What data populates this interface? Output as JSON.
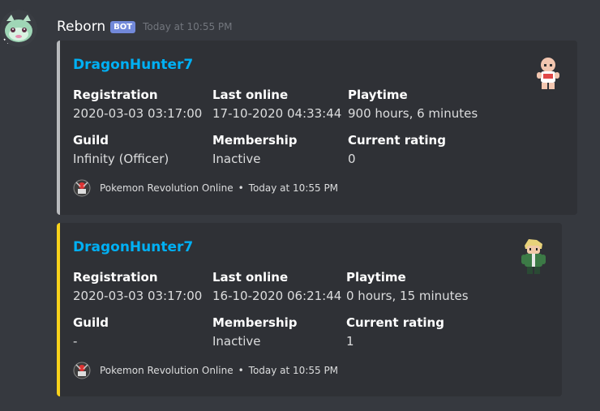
{
  "message": {
    "username": "Reborn",
    "bot_tag": "BOT",
    "timestamp": "Today at 10:55 PM"
  },
  "colors": {
    "embed1_accent": "#b9bbbe",
    "embed2_accent": "#f8d21b",
    "link": "#00b0f4"
  },
  "embeds": [
    {
      "title": "DragonHunter7",
      "fields": [
        {
          "name": "Registration",
          "value": "2020-03-03 03:17:00"
        },
        {
          "name": "Last online",
          "value": "17-10-2020 04:33:44"
        },
        {
          "name": "Playtime",
          "value": "900 hours, 6 minutes"
        },
        {
          "name": "Guild",
          "value": "Infinity (Officer)"
        },
        {
          "name": "Membership",
          "value": "Inactive"
        },
        {
          "name": "Current rating",
          "value": "0"
        }
      ],
      "thumbnail_icon": "bald-character-sprite",
      "footer": {
        "text": "Pokemon Revolution Online",
        "separator": "•",
        "timestamp": "Today at 10:55 PM"
      }
    },
    {
      "title": "DragonHunter7",
      "fields": [
        {
          "name": "Registration",
          "value": "2020-03-03 03:17:00"
        },
        {
          "name": "Last online",
          "value": "16-10-2020 06:21:44"
        },
        {
          "name": "Playtime",
          "value": "0 hours, 15 minutes"
        },
        {
          "name": "Guild",
          "value": "-"
        },
        {
          "name": "Membership",
          "value": "Inactive"
        },
        {
          "name": "Current rating",
          "value": "1"
        }
      ],
      "thumbnail_icon": "blonde-trainer-sprite",
      "footer": {
        "text": "Pokemon Revolution Online",
        "separator": "•",
        "timestamp": "Today at 10:55 PM"
      }
    }
  ]
}
